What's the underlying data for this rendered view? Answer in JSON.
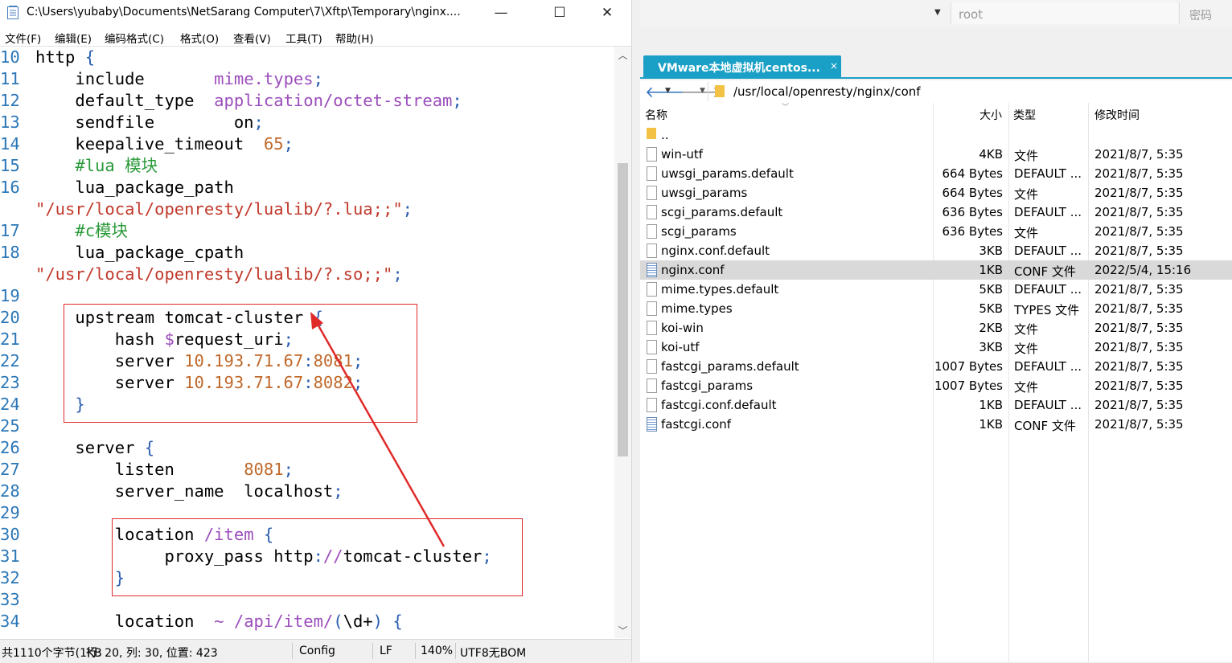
{
  "window": {
    "title": "C:\\Users\\yubaby\\Documents\\NetSarang Computer\\7\\Xftp\\Temporary\\nginx....",
    "minimize": "—",
    "maximize": "☐",
    "close": "✕"
  },
  "menu": [
    "文件(F)",
    "编辑(E)",
    "编码格式(C)",
    "格式(O)",
    "查看(V)",
    "工具(T)",
    "帮助(H)"
  ],
  "code_lines": [
    {
      "n": "10",
      "parts": [
        [
          "kw",
          "http "
        ],
        [
          "pun",
          "{"
        ]
      ]
    },
    {
      "n": "11",
      "parts": [
        [
          "kw",
          "    include       "
        ],
        [
          "val",
          "mime.types"
        ],
        [
          "pun",
          ";"
        ]
      ]
    },
    {
      "n": "12",
      "parts": [
        [
          "kw",
          "    default_type  "
        ],
        [
          "val",
          "application/octet-stream"
        ],
        [
          "pun",
          ";"
        ]
      ]
    },
    {
      "n": "13",
      "parts": [
        [
          "kw",
          "    sendfile        on"
        ],
        [
          "pun",
          ";"
        ]
      ]
    },
    {
      "n": "14",
      "parts": [
        [
          "kw",
          "    keepalive_timeout  "
        ],
        [
          "num",
          "65"
        ],
        [
          "pun",
          ";"
        ]
      ]
    },
    {
      "n": "15",
      "parts": [
        [
          "cmt",
          "    #lua 模块"
        ]
      ]
    },
    {
      "n": "16",
      "parts": [
        [
          "kw",
          "    lua_package_path"
        ]
      ]
    },
    {
      "n": "",
      "indent": 0,
      "parts": [
        [
          "str",
          "\"/usr/local/openresty/lualib/?.lua;;\""
        ],
        [
          "pun",
          ";"
        ]
      ]
    },
    {
      "n": "17",
      "parts": [
        [
          "cmt",
          "    #c模块"
        ]
      ]
    },
    {
      "n": "18",
      "parts": [
        [
          "kw",
          "    lua_package_cpath"
        ]
      ]
    },
    {
      "n": "",
      "indent": 0,
      "parts": [
        [
          "str",
          "\"/usr/local/openresty/lualib/?.so;;\""
        ],
        [
          "pun",
          ";"
        ]
      ]
    },
    {
      "n": "19",
      "parts": [
        [
          "kw",
          ""
        ]
      ]
    },
    {
      "n": "20",
      "parts": [
        [
          "kw",
          "    upstream tomcat-cluster "
        ],
        [
          "pun",
          "{"
        ]
      ]
    },
    {
      "n": "21",
      "parts": [
        [
          "kw",
          "        hash "
        ],
        [
          "val",
          "$"
        ],
        [
          "kw",
          "request_uri"
        ],
        [
          "pun",
          ";"
        ]
      ]
    },
    {
      "n": "22",
      "parts": [
        [
          "kw",
          "        server "
        ],
        [
          "num",
          "10.193.71.67"
        ],
        [
          "pun",
          ":"
        ],
        [
          "num",
          "8081"
        ],
        [
          "pun",
          ";"
        ]
      ]
    },
    {
      "n": "23",
      "parts": [
        [
          "kw",
          "        server "
        ],
        [
          "num",
          "10.193.71.67"
        ],
        [
          "pun",
          ":"
        ],
        [
          "num",
          "8082"
        ],
        [
          "pun",
          ";"
        ]
      ]
    },
    {
      "n": "24",
      "parts": [
        [
          "pun",
          "    }"
        ]
      ]
    },
    {
      "n": "25",
      "parts": [
        [
          "kw",
          ""
        ]
      ]
    },
    {
      "n": "26",
      "parts": [
        [
          "kw",
          "    server "
        ],
        [
          "pun",
          "{"
        ]
      ]
    },
    {
      "n": "27",
      "parts": [
        [
          "kw",
          "        listen       "
        ],
        [
          "num",
          "8081"
        ],
        [
          "pun",
          ";"
        ]
      ]
    },
    {
      "n": "28",
      "parts": [
        [
          "kw",
          "        server_name  localhost"
        ],
        [
          "pun",
          ";"
        ]
      ]
    },
    {
      "n": "29",
      "parts": [
        [
          "kw",
          ""
        ]
      ]
    },
    {
      "n": "30",
      "parts": [
        [
          "kw",
          "        location "
        ],
        [
          "val",
          "/item "
        ],
        [
          "pun",
          "{"
        ]
      ]
    },
    {
      "n": "31",
      "parts": [
        [
          "kw",
          "             proxy_pass http"
        ],
        [
          "pun",
          ":"
        ],
        [
          "val",
          "//"
        ],
        [
          "kw",
          "tomcat-cluster"
        ],
        [
          "pun",
          ";"
        ]
      ]
    },
    {
      "n": "32",
      "parts": [
        [
          "pun",
          "        }"
        ]
      ]
    },
    {
      "n": "33",
      "parts": [
        [
          "kw",
          ""
        ]
      ]
    },
    {
      "n": "34",
      "parts": [
        [
          "kw",
          "        location  "
        ],
        [
          "val",
          "~ /api/item/"
        ],
        [
          "pun",
          "("
        ],
        [
          "kw",
          "\\d+"
        ],
        [
          "pun",
          ") {"
        ]
      ]
    }
  ],
  "statusbar": {
    "size": "共1110个字节(1KB",
    "position": "行: 20,  列: 30,  位置: 423",
    "syntax": "Config",
    "eol": "LF",
    "zoom": "140%",
    "encoding": "UTF8无BOM"
  },
  "xftp": {
    "user": "root",
    "password_placeholder": "密码",
    "tab_label": "VMware本地虚拟机centos...",
    "tab_close": "×",
    "path": "/usr/local/openresty/nginx/conf",
    "columns": {
      "name": "名称",
      "size": "大小",
      "type": "类型",
      "mtime": "修改时间"
    },
    "files": [
      {
        "name": "..",
        "size": "",
        "type": "",
        "mtime": "",
        "icon": "folder"
      },
      {
        "name": "win-utf",
        "size": "4KB",
        "type": "文件",
        "mtime": "2021/8/7, 5:35",
        "icon": "file"
      },
      {
        "name": "uwsgi_params.default",
        "size": "664 Bytes",
        "type": "DEFAULT ...",
        "mtime": "2021/8/7, 5:35",
        "icon": "file"
      },
      {
        "name": "uwsgi_params",
        "size": "664 Bytes",
        "type": "文件",
        "mtime": "2021/8/7, 5:35",
        "icon": "file"
      },
      {
        "name": "scgi_params.default",
        "size": "636 Bytes",
        "type": "DEFAULT ...",
        "mtime": "2021/8/7, 5:35",
        "icon": "file"
      },
      {
        "name": "scgi_params",
        "size": "636 Bytes",
        "type": "文件",
        "mtime": "2021/8/7, 5:35",
        "icon": "file"
      },
      {
        "name": "nginx.conf.default",
        "size": "3KB",
        "type": "DEFAULT ...",
        "mtime": "2021/8/7, 5:35",
        "icon": "file"
      },
      {
        "name": "nginx.conf",
        "size": "1KB",
        "type": "CONF 文件",
        "mtime": "2022/5/4, 15:16",
        "icon": "conf",
        "selected": true
      },
      {
        "name": "mime.types.default",
        "size": "5KB",
        "type": "DEFAULT ...",
        "mtime": "2021/8/7, 5:35",
        "icon": "file"
      },
      {
        "name": "mime.types",
        "size": "5KB",
        "type": "TYPES 文件",
        "mtime": "2021/8/7, 5:35",
        "icon": "file"
      },
      {
        "name": "koi-win",
        "size": "2KB",
        "type": "文件",
        "mtime": "2021/8/7, 5:35",
        "icon": "file"
      },
      {
        "name": "koi-utf",
        "size": "3KB",
        "type": "文件",
        "mtime": "2021/8/7, 5:35",
        "icon": "file"
      },
      {
        "name": "fastcgi_params.default",
        "size": "1007 Bytes",
        "type": "DEFAULT ...",
        "mtime": "2021/8/7, 5:35",
        "icon": "file"
      },
      {
        "name": "fastcgi_params",
        "size": "1007 Bytes",
        "type": "文件",
        "mtime": "2021/8/7, 5:35",
        "icon": "file"
      },
      {
        "name": "fastcgi.conf.default",
        "size": "1KB",
        "type": "DEFAULT ...",
        "mtime": "2021/8/7, 5:35",
        "icon": "file"
      },
      {
        "name": "fastcgi.conf",
        "size": "1KB",
        "type": "CONF 文件",
        "mtime": "2021/8/7, 5:35",
        "icon": "conf"
      }
    ]
  },
  "colors": {
    "accent": "#1aa0c6",
    "annotation": "#e02a2a",
    "line_number": "#2b77b7"
  }
}
